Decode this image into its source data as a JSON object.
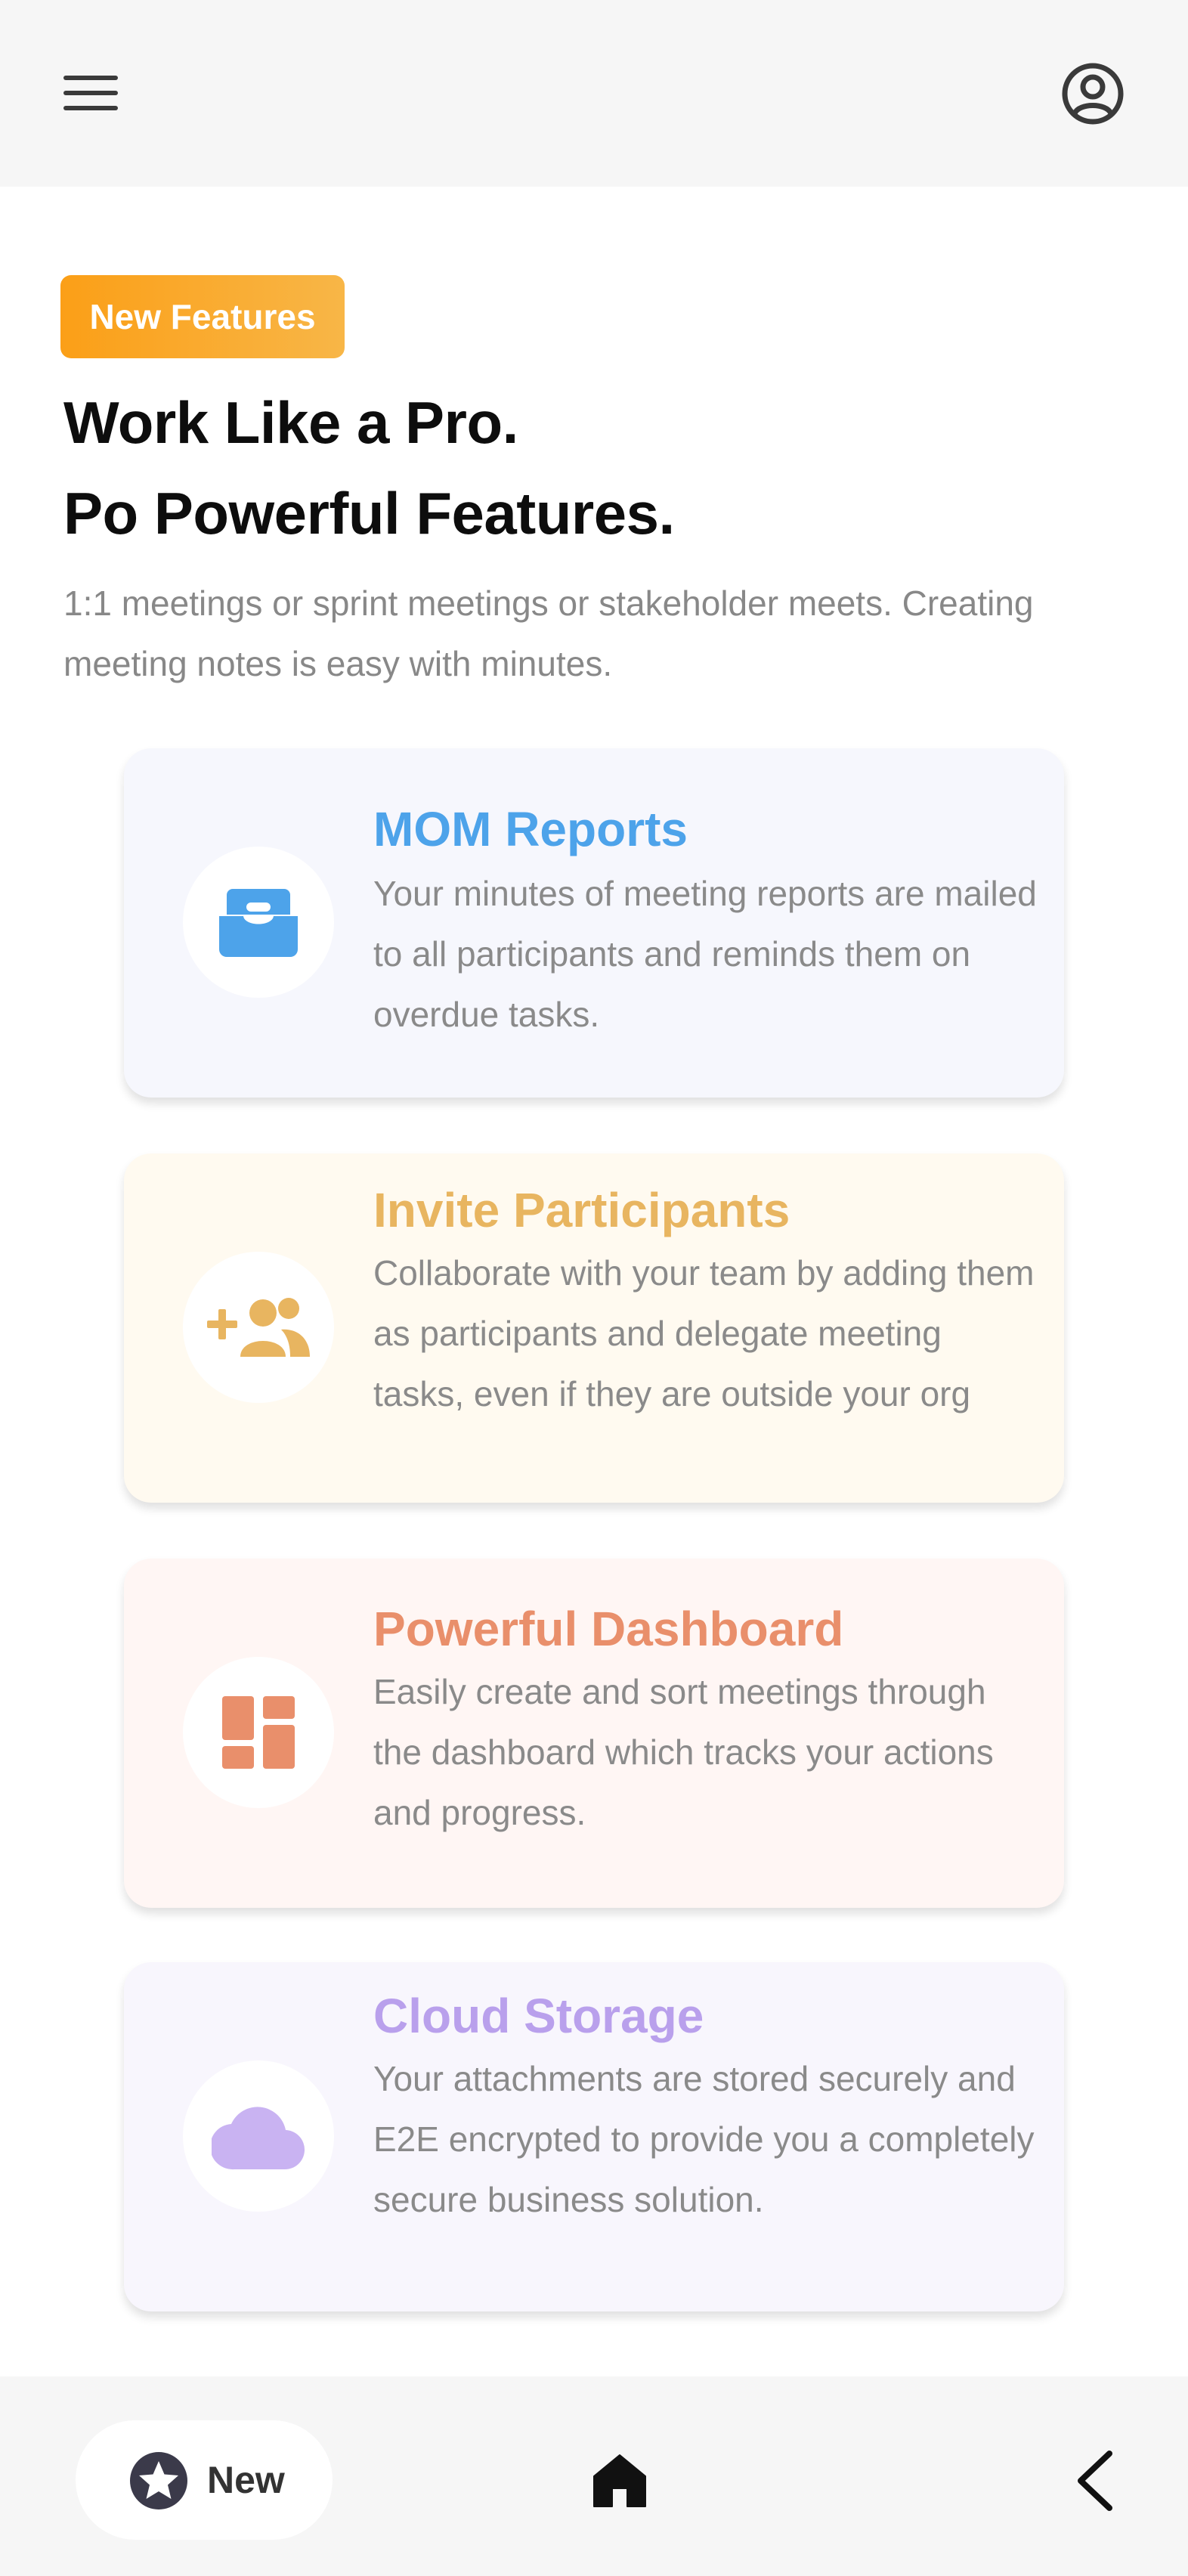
{
  "header": {
    "menu_icon": "hamburger-menu-icon",
    "profile_icon": "user-account-icon"
  },
  "hero": {
    "badge": "New Features",
    "headline_line1": "Work Like a Pro.",
    "headline_line2": "Po Powerful Features.",
    "subtitle": "1:1 meetings or sprint meetings or stakeholder meets. Creating meeting notes is easy with minutes."
  },
  "features": [
    {
      "title": "MOM Reports",
      "description": "Your minutes of meeting reports are mailed to all participants and reminds them on overdue tasks.",
      "icon": "mail-inbox-icon",
      "color": "#4da3ea"
    },
    {
      "title": "Invite Participants",
      "description": "Collaborate with your team by adding them as participants and delegate meeting tasks, even if they are outside your org",
      "icon": "add-group-icon",
      "color": "#e8b560"
    },
    {
      "title": "Powerful Dashboard",
      "description": "Easily create and sort meetings through the dashboard which tracks your actions and progress.",
      "icon": "dashboard-icon",
      "color": "#e98f6b"
    },
    {
      "title": "Cloud Storage",
      "description": "Your attachments are stored securely and E2E encrypted to provide you a completely secure business solution.",
      "icon": "cloud-icon",
      "color": "#b9a0ec"
    }
  ],
  "bottom_nav": {
    "new_label": "New",
    "new_icon": "star-icon",
    "home_icon": "home-icon",
    "back_icon": "chevron-left-icon"
  }
}
